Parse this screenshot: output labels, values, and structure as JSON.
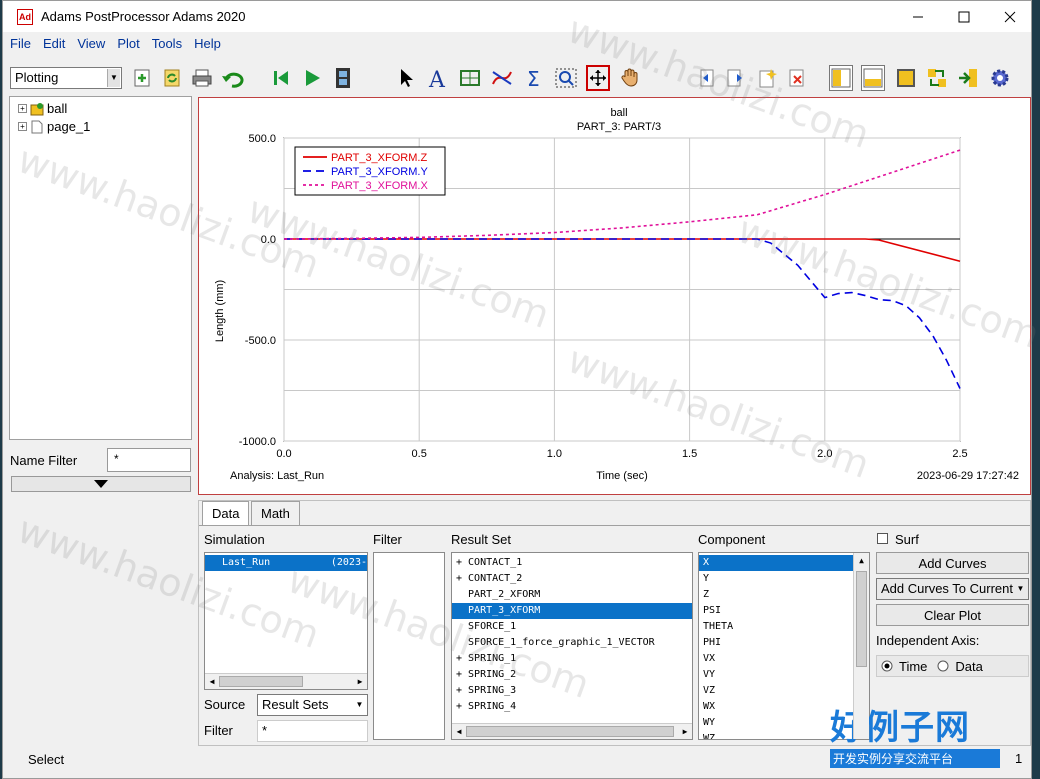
{
  "window": {
    "title": "Adams PostProcessor Adams 2020",
    "icon_text": "Ad"
  },
  "menu": [
    "File",
    "Edit",
    "View",
    "Plot",
    "Tools",
    "Help"
  ],
  "mode_combo": "Plotting",
  "tree": [
    {
      "label": "ball",
      "expand": "+"
    },
    {
      "label": "page_1",
      "expand": "+"
    }
  ],
  "name_filter": {
    "label": "Name Filter",
    "value": "*"
  },
  "plot": {
    "title": "ball",
    "subtitle": "PART_3: PART/3",
    "analysis": "Analysis:  Last_Run",
    "timestamp": "2023-06-29 17:27:42"
  },
  "chart_data": {
    "type": "line",
    "xlabel": "Time (sec)",
    "ylabel": "Length (mm)",
    "xlim": [
      0,
      2.5
    ],
    "ylim": [
      -1000,
      500
    ],
    "xticks": [
      "0.0",
      "0.5",
      "1.0",
      "1.5",
      "2.0",
      "2.5"
    ],
    "yticks": [
      "500.0",
      "0.0",
      "-500.0",
      "-1000.0"
    ],
    "grid": true,
    "legend": "top-left",
    "series": [
      {
        "name": "PART_3_XFORM.Z",
        "color": "#e00000",
        "style": "solid",
        "x": [
          0,
          0.5,
          1.0,
          1.5,
          1.75,
          2.0,
          2.15,
          2.2,
          2.5
        ],
        "y": [
          0,
          0,
          0,
          0,
          0,
          0,
          0,
          -5,
          -110
        ]
      },
      {
        "name": "PART_3_XFORM.Y",
        "color": "#0000e0",
        "style": "dashed",
        "x": [
          0,
          0.5,
          1.0,
          1.5,
          1.75,
          1.8,
          1.9,
          2.0,
          2.05,
          2.1,
          2.15,
          2.2,
          2.25,
          2.3,
          2.35,
          2.4,
          2.45,
          2.5
        ],
        "y": [
          0,
          0,
          0,
          0,
          0,
          -20,
          -130,
          -290,
          -270,
          -265,
          -280,
          -300,
          -305,
          -330,
          -390,
          -480,
          -600,
          -740
        ]
      },
      {
        "name": "PART_3_XFORM.X",
        "color": "#e0109a",
        "style": "dotted",
        "x": [
          0,
          0.25,
          0.5,
          0.75,
          1.0,
          1.25,
          1.5,
          1.75,
          2.0,
          2.25,
          2.5
        ],
        "y": [
          0,
          3,
          8,
          18,
          32,
          55,
          85,
          120,
          220,
          330,
          440
        ]
      }
    ]
  },
  "tabs": [
    "Data",
    "Math"
  ],
  "simulation": {
    "label": "Simulation",
    "items": [
      "Last_Run",
      "(2023-"
    ]
  },
  "filter": {
    "label": "Filter"
  },
  "result_set": {
    "label": "Result Set",
    "items": [
      {
        "text": "+ CONTACT_1"
      },
      {
        "text": "+ CONTACT_2"
      },
      {
        "text": "  PART_2_XFORM"
      },
      {
        "text": "  PART_3_XFORM",
        "selected": true
      },
      {
        "text": "  SFORCE_1"
      },
      {
        "text": "  SFORCE_1_force_graphic_1_VECTOR"
      },
      {
        "text": "+ SPRING_1"
      },
      {
        "text": "+ SPRING_2"
      },
      {
        "text": "+ SPRING_3"
      },
      {
        "text": "+ SPRING_4"
      }
    ]
  },
  "component": {
    "label": "Component",
    "items": [
      "X",
      "Y",
      "Z",
      "PSI",
      "THETA",
      "PHI",
      "VX",
      "VY",
      "VZ",
      "WX",
      "WY",
      "WZ"
    ]
  },
  "surf_label": "Surf",
  "add_curves": "Add Curves",
  "add_curves_combo": "Add Curves To Current",
  "clear_plot": "Clear Plot",
  "independent_axis": {
    "label": "Independent Axis:",
    "time": "Time",
    "data": "Data"
  },
  "source": {
    "label": "Source",
    "value": "Result Sets"
  },
  "bottom_filter": {
    "label": "Filter",
    "value": "*"
  },
  "status": {
    "text": "Select",
    "page": "1"
  },
  "watermark": "www.haolizi.com",
  "brand": {
    "name": "好例子网",
    "slogan": "开发实例分享交流平台"
  }
}
